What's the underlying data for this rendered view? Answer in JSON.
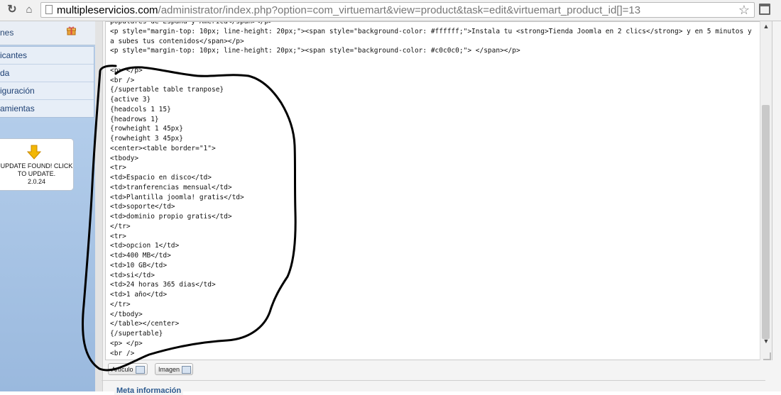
{
  "browser": {
    "url_host": "multipleservicios.com",
    "url_path": "/administrator/index.php?option=com_virtuemart&view=product&task=edit&virtuemart_product_id[]=13",
    "reload_icon": "reload-icon",
    "home_icon": "home-icon",
    "star_icon": "star-icon"
  },
  "sidebar": {
    "top_label": "nes",
    "menu": [
      "icantes",
      "da",
      "iguración",
      "amientas"
    ],
    "update": {
      "line1": "UPDATE FOUND! CLICK",
      "line2": "TO UPDATE.",
      "version": "2.0.24"
    }
  },
  "editor": {
    "lines": [
      "populares de España y América</span></p>",
      "<p style=\"margin-top: 10px; line-height: 20px;\"><span style=\"background-color: #ffffff;\">Instala tu <strong>Tienda Joomla en 2 clics</strong> y en 5 minutos ya subes tus contenidos</span></p>",
      "<p style=\"margin-top: 10px; line-height: 20px;\"><span style=\"background-color: #c0c0c0;\"> </span></p>",
      "",
      "<p> </p>",
      "<br />",
      "{/supertable table tranpose}",
      "{active 3}",
      "{headcols 1 15}",
      "{headrows 1}",
      "{rowheight 1 45px}",
      "{rowheight 3 45px}",
      "<center><table border=\"1\">",
      "<tbody>",
      "<tr>",
      "<td>Espacio en disco</td>",
      "<td>tranferencias mensual</td>",
      "<td>Plantilla joomla! gratis</td>",
      "<td>soporte</td>",
      "<td>dominio propio gratis</td>",
      "</tr>",
      "<tr>",
      "<td>opcion 1</td>",
      "<td>400 MB</td>",
      "<td>10 GB</td>",
      "<td>si</td>",
      "<td>24 horas 365 dias</td>",
      "<td>1 año</td>",
      "</tr>",
      "</tbody>",
      "</table></center>",
      "{/supertable}",
      "<p> </p>",
      "<br />"
    ],
    "buttons": {
      "articulo": "Artículo",
      "imagen": "Imagen"
    }
  },
  "meta_legend": "Meta información"
}
